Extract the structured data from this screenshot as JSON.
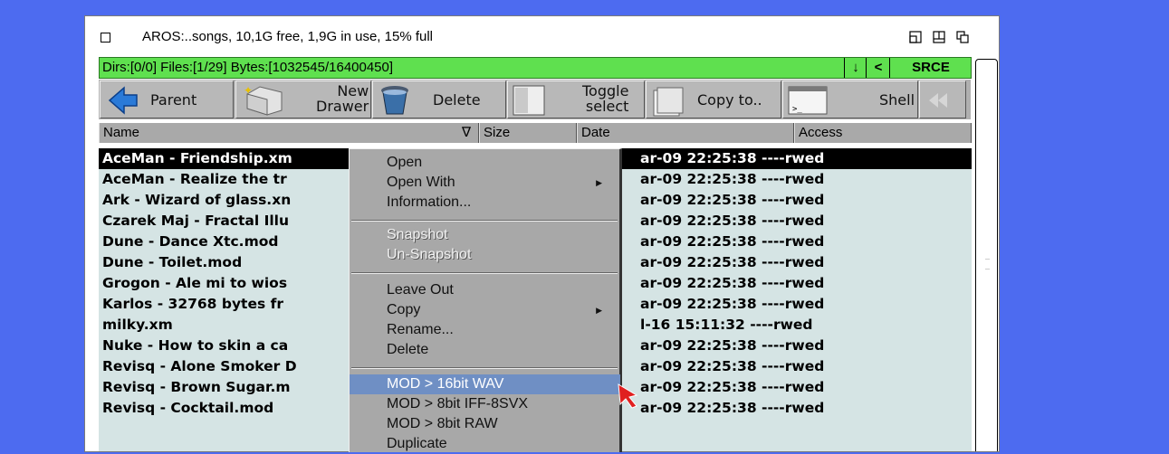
{
  "window": {
    "title": "AROS:..songs,  10,1G free, 1,9G in use, 15% full"
  },
  "status": {
    "text": "Dirs:[0/0] Files:[1/29] Bytes:[1032545/16400450]",
    "down_btn": "↓",
    "left_btn": "<",
    "srce_btn": "SRCE"
  },
  "toolbar": {
    "parent": "Parent",
    "new_drawer": "New\nDrawer",
    "delete": "Delete",
    "toggle_select": "Toggle\nselect",
    "copy_to": "Copy to..",
    "shell": "Shell"
  },
  "columns": {
    "name": "Name",
    "size": "Size",
    "date": "Date",
    "access": "Access",
    "sort_indicator": "∇"
  },
  "files": [
    {
      "name": "AceMan - Friendship.xm",
      "meta": "ar-09 22:25:38 ----rwed"
    },
    {
      "name": "AceMan - Realize the tr",
      "meta": "ar-09 22:25:38 ----rwed"
    },
    {
      "name": "Ark - Wizard of glass.xn",
      "meta": "ar-09 22:25:38 ----rwed"
    },
    {
      "name": "Czarek Maj - Fractal Illu",
      "meta": "ar-09 22:25:38 ----rwed"
    },
    {
      "name": "Dune - Dance Xtc.mod",
      "meta": "ar-09 22:25:38 ----rwed"
    },
    {
      "name": "Dune - Toilet.mod",
      "meta": "ar-09 22:25:38 ----rwed"
    },
    {
      "name": "Grogon - Ale mi to wios",
      "meta": "ar-09 22:25:38 ----rwed"
    },
    {
      "name": "Karlos - 32768 bytes fr",
      "meta": "ar-09 22:25:38 ----rwed"
    },
    {
      "name": "milky.xm",
      "meta": "l-16  15:11:32 ----rwed"
    },
    {
      "name": "Nuke - How to skin a ca",
      "meta": "ar-09 22:25:38 ----rwed"
    },
    {
      "name": "Revisq - Alone Smoker D",
      "meta": "ar-09 22:25:38 ----rwed"
    },
    {
      "name": "Revisq - Brown Sugar.m",
      "meta": "ar-09 22:25:38 ----rwed"
    },
    {
      "name": "Revisq - Cocktail.mod",
      "meta": "ar-09 22:25:38 ----rwed"
    }
  ],
  "menu": {
    "open": "Open",
    "open_with": "Open With",
    "information": "Information...",
    "snapshot": "Snapshot",
    "unsnapshot": "Un-Snapshot",
    "leave_out": "Leave Out",
    "copy": "Copy",
    "rename": "Rename...",
    "delete": "Delete",
    "mod_16bit_wav": "MOD > 16bit WAV",
    "mod_8bit_iff": "MOD > 8bit IFF-8SVX",
    "mod_8bit_raw": "MOD > 8bit RAW",
    "duplicate": "Duplicate",
    "submenu_arrow": "▶"
  },
  "colors": {
    "desktop": "#4d6bf0",
    "status_bar": "#5fe04f",
    "list_bg": "#d5e4e4",
    "menu_highlight": "#6f8fc4"
  }
}
